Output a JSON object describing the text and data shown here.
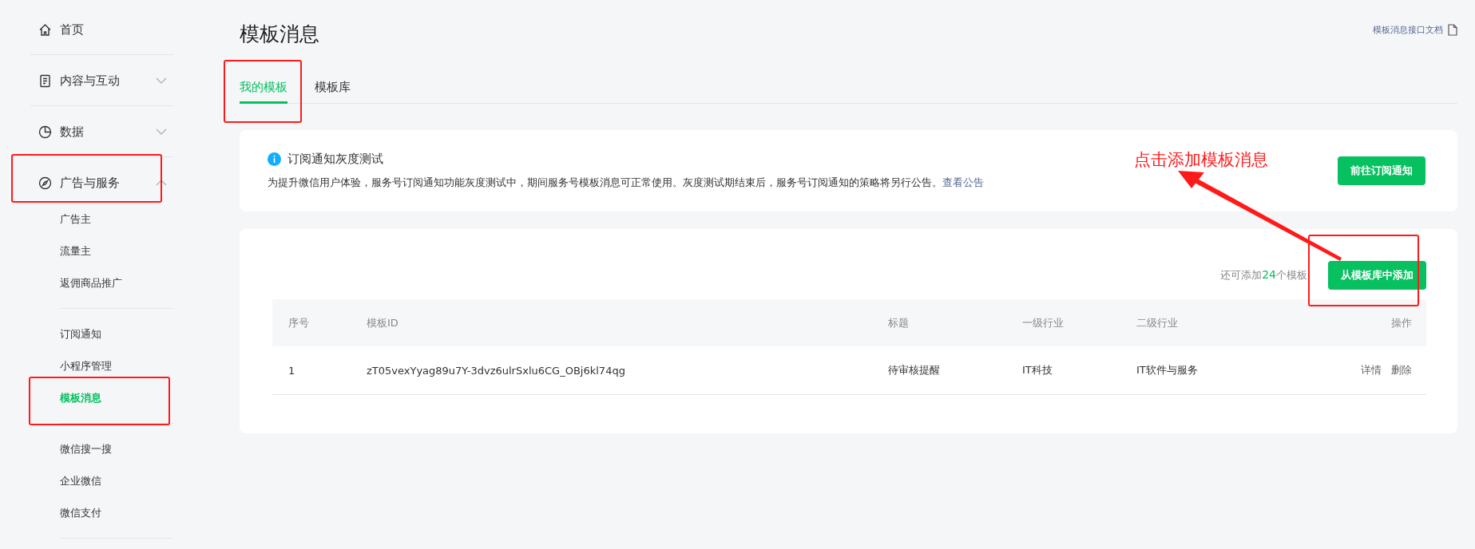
{
  "sidebar": {
    "sections": [
      {
        "label": "首页",
        "kind": "link"
      },
      {
        "label": "内容与互动",
        "kind": "menu",
        "expanded": false
      },
      {
        "label": "数据",
        "kind": "menu",
        "expanded": false
      },
      {
        "label": "广告与服务",
        "kind": "menu",
        "expanded": true,
        "groups": [
          [
            {
              "label": "广告主",
              "selected": false
            },
            {
              "label": "流量主",
              "selected": false
            },
            {
              "label": "返佣商品推广",
              "selected": false
            }
          ],
          [
            {
              "label": "订阅通知",
              "selected": false
            },
            {
              "label": "小程序管理",
              "selected": false
            },
            {
              "label": "模板消息",
              "selected": true
            }
          ],
          [
            {
              "label": "微信搜一搜",
              "selected": false
            },
            {
              "label": "企业微信",
              "selected": false
            },
            {
              "label": "微信支付",
              "selected": false
            }
          ]
        ]
      }
    ]
  },
  "page": {
    "title": "模板消息",
    "doc_link": "模板消息接口文档"
  },
  "tabs": [
    {
      "label": "我的模板",
      "selected": true
    },
    {
      "label": "模板库",
      "selected": false
    }
  ],
  "notice": {
    "title": "订阅通知灰度测试",
    "text": "为提升微信用户体验，服务号订阅通知功能灰度测试中，期间服务号模板消息可正常使用。灰度测试期结束后，服务号订阅通知的策略将另行公告。",
    "link": "查看公告",
    "button": "前往订阅通知"
  },
  "templates": {
    "quota_prefix": "还可添加",
    "quota_count": "24",
    "quota_suffix": "个模板",
    "add_button": "从模板库中添加",
    "columns": [
      "序号",
      "模板ID",
      "标题",
      "一级行业",
      "二级行业",
      "操作"
    ],
    "rows": [
      {
        "cells": [
          "1",
          "zT05vexYyag89u7Y-3dvz6ulrSxlu6CG_OBj6kl74qg",
          "待审核提醒",
          "IT科技",
          "IT软件与服务"
        ],
        "actions": [
          "详情",
          "删除"
        ]
      }
    ]
  },
  "annotation": {
    "text": "点击添加模板消息"
  }
}
